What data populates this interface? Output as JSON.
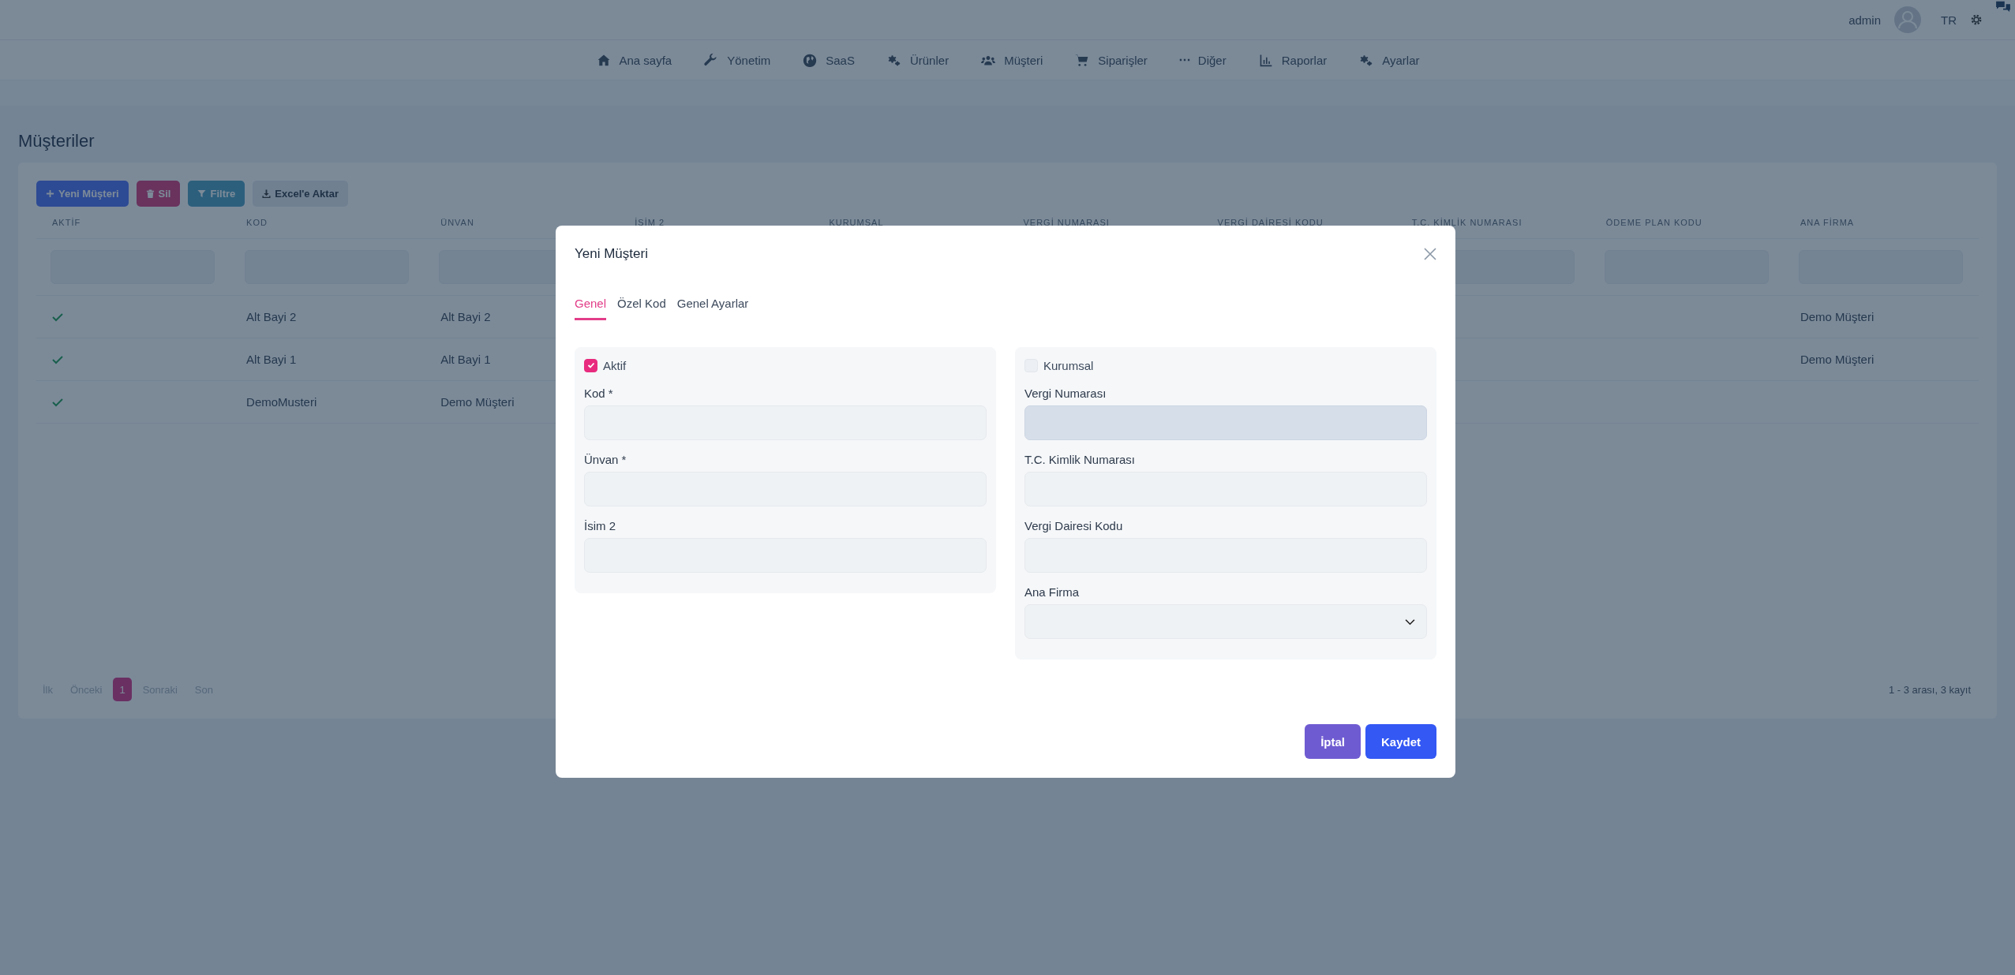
{
  "topbar": {
    "user": "admin",
    "language": "TR"
  },
  "nav": [
    {
      "label": "Ana sayfa"
    },
    {
      "label": "Yönetim"
    },
    {
      "label": "SaaS"
    },
    {
      "label": "Ürünler"
    },
    {
      "label": "Müşteri"
    },
    {
      "label": "Siparişler"
    },
    {
      "label": "Diğer"
    },
    {
      "label": "Raporlar"
    },
    {
      "label": "Ayarlar"
    }
  ],
  "page_title": "Müşteriler",
  "toolbar": [
    {
      "label": "Yeni Müşteri",
      "kind": "new"
    },
    {
      "label": "Sil",
      "kind": "delete"
    },
    {
      "label": "Filtre",
      "kind": "filter"
    },
    {
      "label": "Excel'e Aktar",
      "kind": "export"
    }
  ],
  "table": {
    "columns": [
      "AKTİF",
      "KOD",
      "ÜNVAN",
      "İSİM 2",
      "KURUMSAL",
      "VERGİ NUMARASI",
      "VERGİ DAİRESİ KODU",
      "T.C. KİMLİK NUMARASI",
      "ÖDEME PLAN KODU",
      "ANA FİRMA"
    ],
    "rows": [
      {
        "aktif": true,
        "kod": "Alt Bayi 2",
        "unvan": "Alt Bayi 2",
        "ana_firma": "Demo Müşteri"
      },
      {
        "aktif": true,
        "kod": "Alt Bayi 1",
        "unvan": "Alt Bayi 1",
        "ana_firma": "Demo Müşteri"
      },
      {
        "aktif": true,
        "kod": "DemoMusteri",
        "unvan": "Demo Müşteri"
      }
    ]
  },
  "pagination": {
    "pages": [
      {
        "label": "İlk",
        "selected": false
      },
      {
        "label": "Önceki",
        "selected": false
      },
      {
        "label": "1",
        "selected": true
      },
      {
        "label": "Sonraki",
        "selected": false
      },
      {
        "label": "Son",
        "selected": false
      }
    ],
    "summary": "1 - 3 arası, 3 kayıt"
  },
  "modal": {
    "title": "Yeni Müşteri",
    "tabs": [
      {
        "label": "Genel",
        "selected": true
      },
      {
        "label": "Özel Kod",
        "selected": false
      },
      {
        "label": "Genel Ayarlar",
        "selected": false
      }
    ],
    "panels": [
      {
        "checkbox": {
          "label": "Aktif",
          "checked": true
        },
        "fields": [
          {
            "label": "Kod *",
            "kind": "text",
            "disabled": false
          },
          {
            "label": "Ünvan *",
            "kind": "text",
            "disabled": false
          },
          {
            "label": "İsim 2",
            "kind": "text",
            "disabled": false
          }
        ]
      },
      {
        "checkbox": {
          "label": "Kurumsal",
          "checked": false
        },
        "fields": [
          {
            "label": "Vergi Numarası",
            "kind": "text",
            "disabled": true
          },
          {
            "label": "T.C. Kimlik Numarası",
            "kind": "text",
            "disabled": false
          },
          {
            "label": "Vergi Dairesi Kodu",
            "kind": "text",
            "disabled": false
          },
          {
            "label": "Ana Firma",
            "kind": "select",
            "disabled": false
          }
        ]
      }
    ],
    "buttons": [
      {
        "label": "İptal",
        "kind": "cancel"
      },
      {
        "label": "Kaydet",
        "kind": "save"
      }
    ]
  }
}
